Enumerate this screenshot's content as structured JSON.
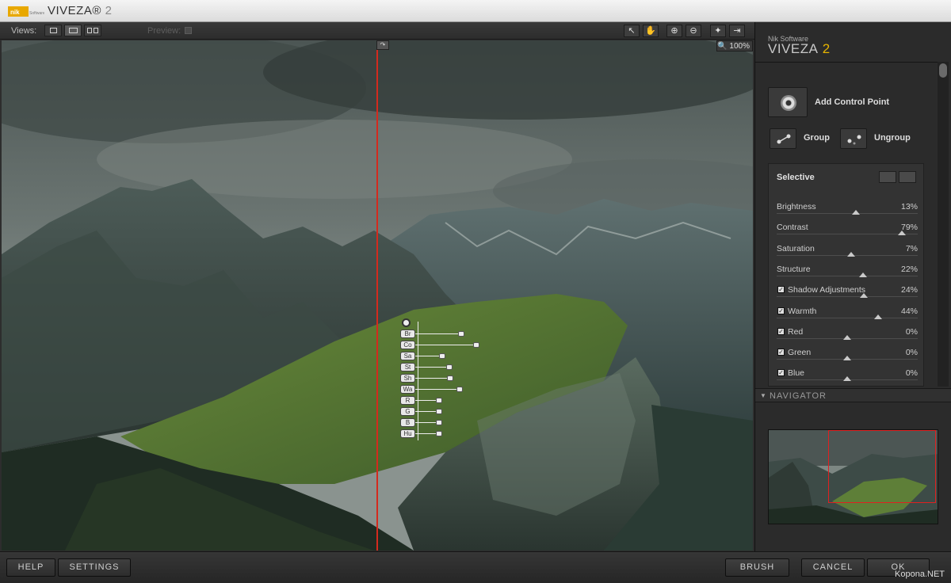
{
  "window": {
    "title": "VIVEZA",
    "title_version": "2",
    "logo_icon": "nik-software-logo"
  },
  "toolbar": {
    "views_label": "Views:",
    "preview_label": "Preview:",
    "view_modes": [
      "single-view-icon",
      "split-view-icon",
      "side-by-side-view-icon"
    ],
    "active_view": "split-view-icon",
    "tools": [
      "arrow-select-icon",
      "hand-pan-icon",
      "zoom-in-icon",
      "zoom-out-icon",
      "lightbulb-icon",
      "export-icon"
    ]
  },
  "canvas": {
    "zoom_label": "100%",
    "zoom_icon": "magnifier-icon",
    "split_line_color": "#d42a1e"
  },
  "control_point": {
    "rows": [
      {
        "label": "Br",
        "value": 0.13
      },
      {
        "label": "Co",
        "value": 0.79
      },
      {
        "label": "Sa",
        "value": 0.07
      },
      {
        "label": "St",
        "value": 0.22
      },
      {
        "label": "Sh",
        "value": 0.24
      },
      {
        "label": "Wa",
        "value": 0.44
      },
      {
        "label": "R",
        "value": 0.0
      },
      {
        "label": "G",
        "value": 0.0
      },
      {
        "label": "B",
        "value": 0.0
      },
      {
        "label": "Hu",
        "value": 0.0
      }
    ]
  },
  "panel": {
    "brand_small": "Nik Software",
    "brand_big": "VIVEZA",
    "brand_version": "2",
    "add_control_point_label": "Add Control Point",
    "group_label": "Group",
    "ungroup_label": "Ungroup",
    "selective": {
      "title": "Selective",
      "sliders": [
        {
          "label": "Brightness",
          "value": "13%",
          "checkbox": false,
          "pos": 0.56
        },
        {
          "label": "Contrast",
          "value": "79%",
          "checkbox": false,
          "pos": 0.89
        },
        {
          "label": "Saturation",
          "value": "7%",
          "checkbox": false,
          "pos": 0.53
        },
        {
          "label": "Structure",
          "value": "22%",
          "checkbox": false,
          "pos": 0.61
        },
        {
          "label": "Shadow Adjustments",
          "value": "24%",
          "checkbox": true,
          "pos": 0.62
        },
        {
          "label": "Warmth",
          "value": "44%",
          "checkbox": true,
          "pos": 0.72
        },
        {
          "label": "Red",
          "value": "0%",
          "checkbox": true,
          "pos": 0.5
        },
        {
          "label": "Green",
          "value": "0%",
          "checkbox": true,
          "pos": 0.5
        },
        {
          "label": "Blue",
          "value": "0%",
          "checkbox": true,
          "pos": 0.5
        }
      ]
    },
    "navigator_label": "NAVIGATOR"
  },
  "bottom": {
    "help": "HELP",
    "settings": "SETTINGS",
    "brush": "BRUSH",
    "cancel": "CANCEL",
    "ok": "OK",
    "watermark": "Kopona.NET"
  }
}
